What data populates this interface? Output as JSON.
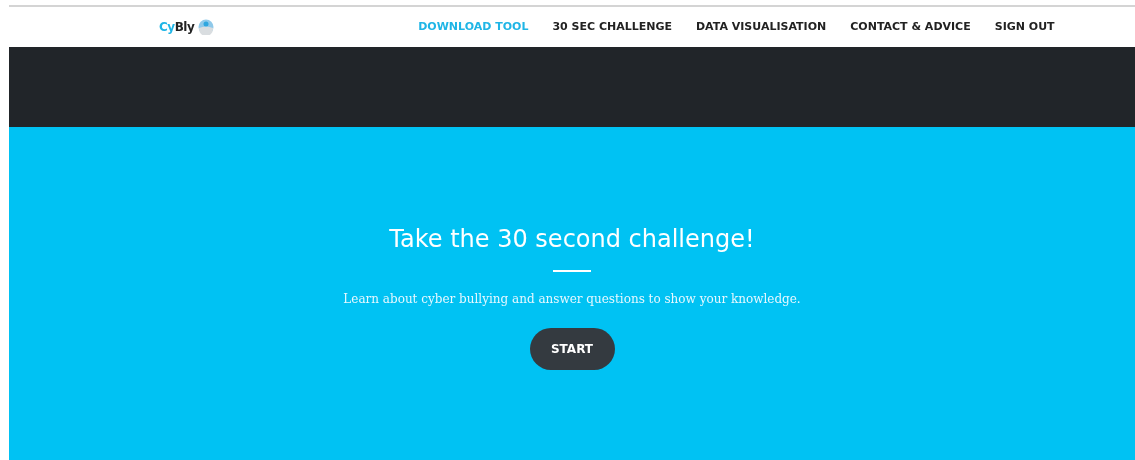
{
  "navbar": {
    "logo": {
      "parts": [
        {
          "text": "Cy",
          "color": "#1fb5e6"
        },
        {
          "text": "Bly",
          "color": "#222222"
        }
      ]
    },
    "items": [
      {
        "label": "DOWNLOAD TOOL",
        "selected": true
      },
      {
        "label": "30 SEC CHALLENGE",
        "selected": false
      },
      {
        "label": "DATA VISUALISATION",
        "selected": false
      },
      {
        "label": "CONTACT & ADVICE",
        "selected": false
      },
      {
        "label": "SIGN OUT",
        "selected": false
      }
    ]
  },
  "hero": {
    "title": "Take the 30 second challenge!",
    "subtitle": "Learn about cyber bullying and answer questions to show your knowledge.",
    "button": "START"
  }
}
